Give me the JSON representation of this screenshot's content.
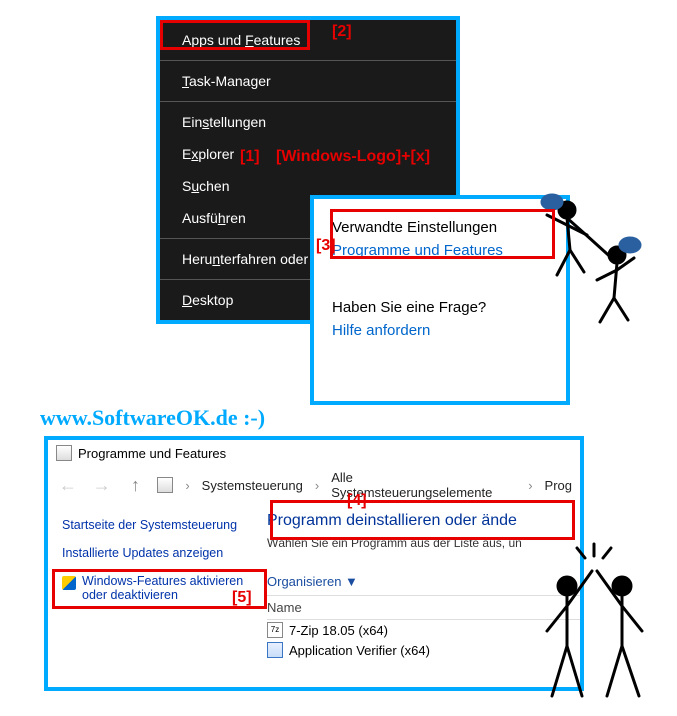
{
  "context_menu": {
    "items": [
      {
        "label_pre": "Apps und ",
        "hot": "F",
        "label_post": "eatures"
      },
      {
        "label_pre": "",
        "hot": "T",
        "label_post": "ask-Manager"
      },
      {
        "label_pre": "Ein",
        "hot": "s",
        "label_post": "tellungen"
      },
      {
        "label_pre": "E",
        "hot": "x",
        "label_post": "plorer"
      },
      {
        "label_pre": "S",
        "hot": "u",
        "label_post": "chen"
      },
      {
        "label_pre": "Ausfü",
        "hot": "h",
        "label_post": "ren"
      },
      {
        "label_pre": "Heru",
        "hot": "n",
        "label_post": "terfahren oder abmelden"
      },
      {
        "label_pre": "",
        "hot": "D",
        "label_post": "esktop"
      }
    ]
  },
  "annotations": {
    "n1": "[1]",
    "n2": "[2]",
    "n3": "[3]",
    "n4": "[4]",
    "n5": "[5]",
    "shortcut": "[Windows-Logo]+[x]"
  },
  "right_panel": {
    "heading": "Verwandte Einstellungen",
    "link": "Programme und Features",
    "question": "Haben Sie eine Frage?",
    "help": "Hilfe anfordern"
  },
  "watermark": "www.SoftwareOK.de :-)",
  "bottom_window": {
    "title": "Programme und Features",
    "breadcrumbs": {
      "c1": "Systemsteuerung",
      "c2": "Alle Systemsteuerungselemente",
      "c3": "Prog"
    },
    "left_links": {
      "home": "Startseite der Systemsteuerung",
      "updates": "Installierte Updates anzeigen",
      "features": "Windows-Features aktivieren oder deaktivieren"
    },
    "heading": "Programm deinstallieren oder ände",
    "subtext": "Wählen Sie ein Programm aus der Liste aus, un",
    "organize": "Organisieren  ▼",
    "col_name": "Name",
    "apps": {
      "a1": "7-Zip 18.05 (x64)",
      "a2": "Application Verifier (x64)"
    }
  }
}
